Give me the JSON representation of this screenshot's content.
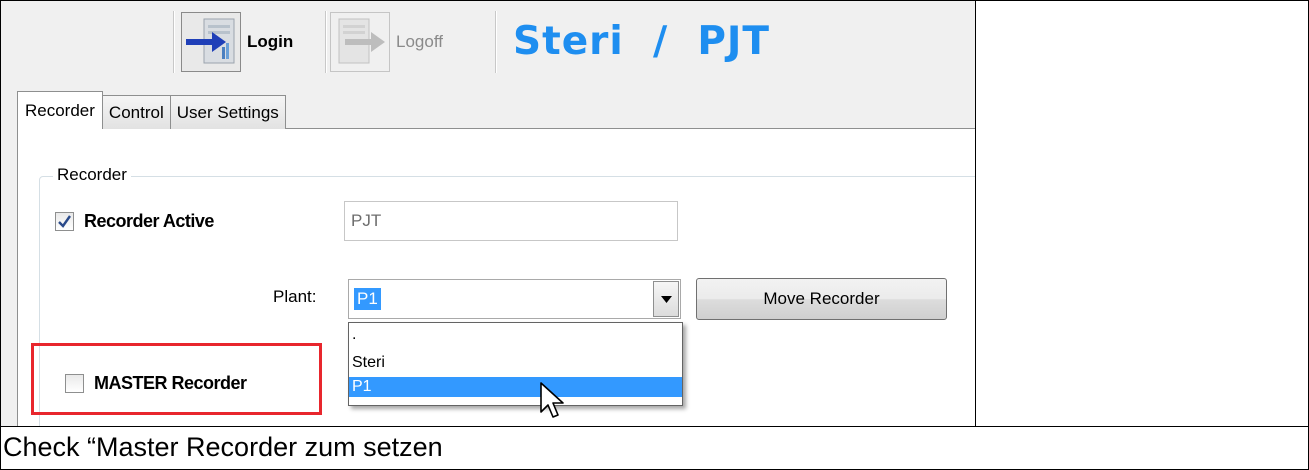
{
  "toolbar": {
    "login_label": "Login",
    "logoff_label": "Logoff",
    "title": "Steri  /  PJT"
  },
  "tabs": [
    {
      "label": "Recorder",
      "active": true
    },
    {
      "label": "Control",
      "active": false
    },
    {
      "label": "User Settings",
      "active": false
    }
  ],
  "recorder_group": {
    "legend": "Recorder",
    "recorder_active": {
      "label": "Recorder Active",
      "checked": true
    },
    "name_field": {
      "value": "PJT"
    },
    "plant": {
      "label": "Plant:",
      "selected": "P1",
      "options": [
        ".",
        "Steri",
        "P1"
      ],
      "highlighted_option": "P1"
    },
    "move_button_label": "Move Recorder",
    "master_recorder": {
      "label": "MASTER Recorder",
      "checked": false
    }
  },
  "caption": "Check “Master Recorder zum setzen",
  "colors": {
    "title_blue": "#1e8ef0",
    "selection_blue": "#3399ff",
    "highlight_red": "#e8262d"
  }
}
